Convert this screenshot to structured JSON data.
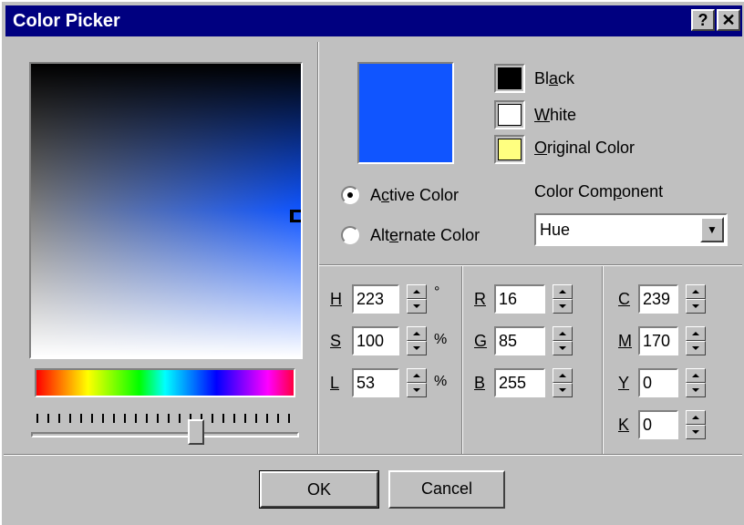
{
  "window": {
    "title": "Color Picker",
    "help_glyph": "?",
    "close_glyph": "✕"
  },
  "gradient": {
    "base_color": "#1055ff"
  },
  "preview": {
    "active_color": "#1055ff"
  },
  "swatches": {
    "black": {
      "label": "Black",
      "color": "#000000"
    },
    "white": {
      "label": "White",
      "color": "#ffffff"
    },
    "original": {
      "label": "Original Color",
      "color": "#ffff80"
    }
  },
  "radios": {
    "active_label": "Active Color",
    "alternate_label": "Alternate Color",
    "selected": "active"
  },
  "component": {
    "label": "Color Component",
    "selected": "Hue"
  },
  "hsl": {
    "h": {
      "label": "H",
      "value": "223",
      "unit": "°"
    },
    "s": {
      "label": "S",
      "value": "100",
      "unit": "%"
    },
    "l": {
      "label": "L",
      "value": "53",
      "unit": "%"
    }
  },
  "rgb": {
    "r": {
      "label": "R",
      "value": "16"
    },
    "g": {
      "label": "G",
      "value": "85"
    },
    "b": {
      "label": "B",
      "value": "255"
    }
  },
  "cmyk": {
    "c": {
      "label": "C",
      "value": "239"
    },
    "m": {
      "label": "M",
      "value": "170"
    },
    "y": {
      "label": "Y",
      "value": "0"
    },
    "k": {
      "label": "K",
      "value": "0"
    }
  },
  "buttons": {
    "ok": "OK",
    "cancel": "Cancel"
  }
}
